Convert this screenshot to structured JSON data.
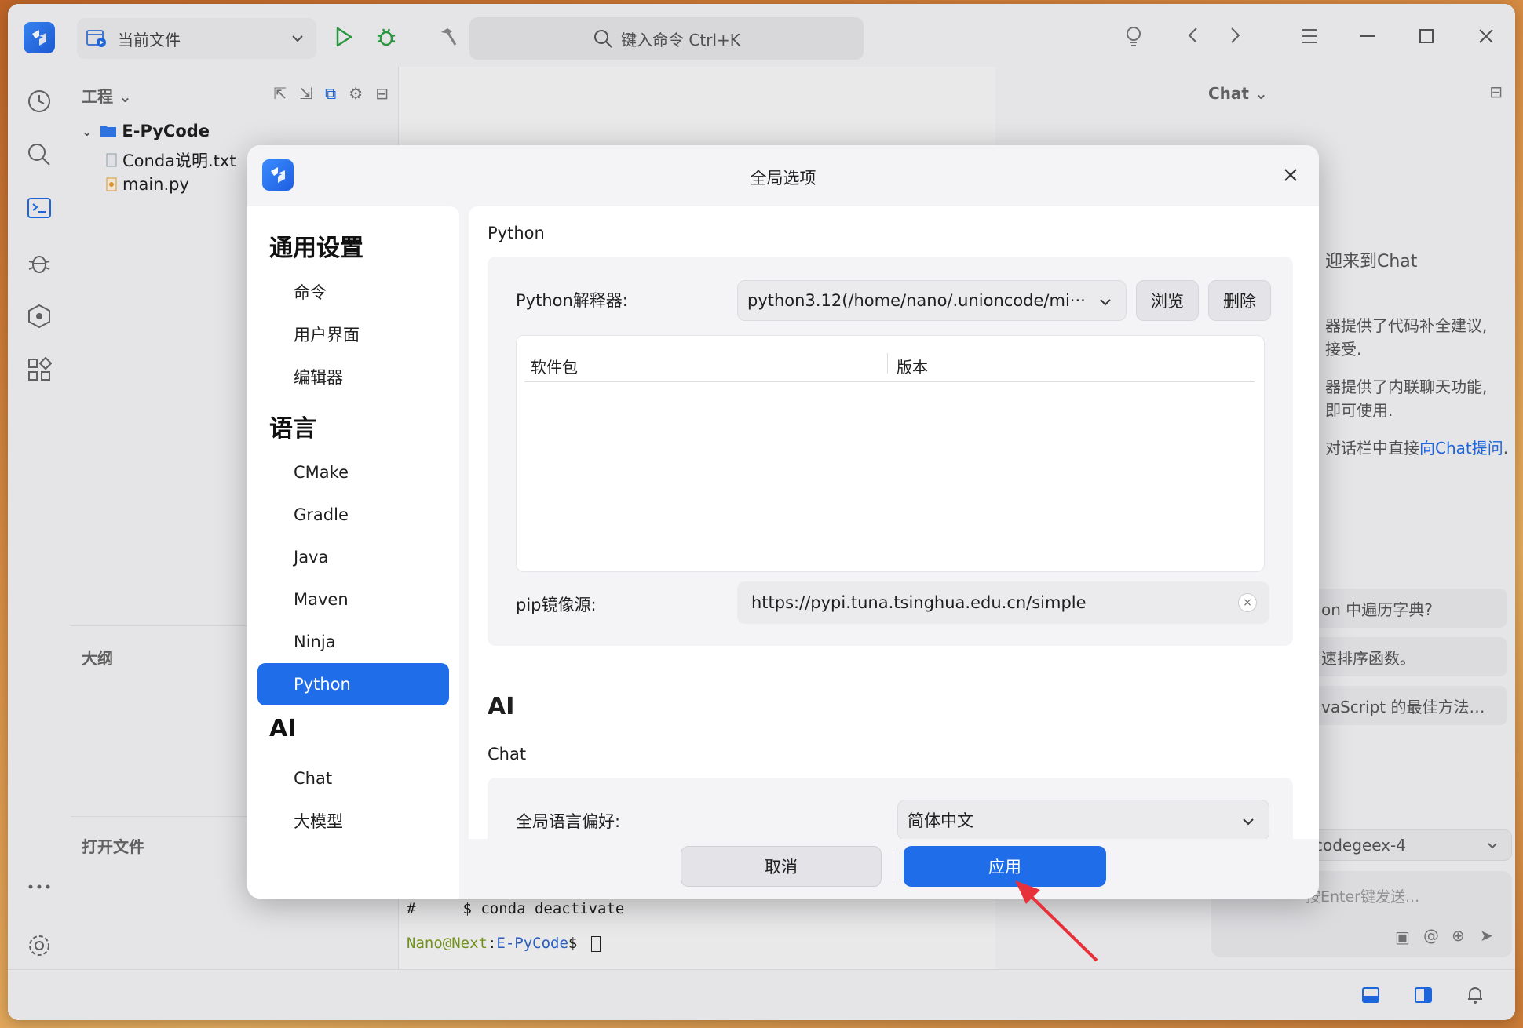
{
  "titlebar": {
    "target_label": "当前文件",
    "search_placeholder": "键入命令 Ctrl+K"
  },
  "project_panel": {
    "title": "工程",
    "root": "E-PyCode",
    "files": [
      "Conda说明.txt",
      "main.py"
    ],
    "outline_title": "大纲",
    "open_files_title": "打开文件"
  },
  "terminal": {
    "line1_hash": "#",
    "line1_cmd": "$ conda deactivate",
    "prompt_user": "Nano@Next",
    "prompt_sep": ":",
    "prompt_path": "E-PyCode",
    "prompt_dollar": "$"
  },
  "chat_panel": {
    "title": "Chat",
    "welcome": "迎来到Chat",
    "desc1a": "器提供了代码补全建议,",
    "desc1b": "接受.",
    "desc2a": "器提供了内联聊天功能,",
    "desc2b": "即可使用.",
    "desc3": "对话栏中直接",
    "desc3_link": "向Chat提问",
    "desc3_end": ".",
    "chips": [
      "on 中遍历字典?",
      "速排序函数。",
      "vaScript 的最佳方法…"
    ],
    "model": "codegeex-4",
    "input_placeholder": "按Enter键发送..."
  },
  "dialog": {
    "title": "全局选项",
    "nav": {
      "general_title": "通用设置",
      "general_items": [
        "命令",
        "用户界面",
        "编辑器"
      ],
      "language_title": "语言",
      "language_items": [
        "CMake",
        "Gradle",
        "Java",
        "Maven",
        "Ninja",
        "Python"
      ],
      "ai_title": "AI",
      "ai_items": [
        "Chat",
        "大模型"
      ]
    },
    "python_section": {
      "title": "Python",
      "interpreter_label": "Python解释器:",
      "interpreter_value": "python3.12(/home/nano/.unioncode/mi···",
      "browse": "浏览",
      "delete": "删除",
      "col_package": "软件包",
      "col_version": "版本",
      "pip_label": "pip镜像源:",
      "pip_value": "https://pypi.tuna.tsinghua.edu.cn/simple"
    },
    "ai_section": {
      "title": "AI",
      "chat_title": "Chat",
      "lang_pref_label": "全局语言偏好:",
      "lang_pref_value": "简体中文"
    },
    "cancel": "取消",
    "apply": "应用"
  },
  "colors": {
    "accent": "#1f6de8",
    "annotation_arrow": "#e8303a"
  }
}
